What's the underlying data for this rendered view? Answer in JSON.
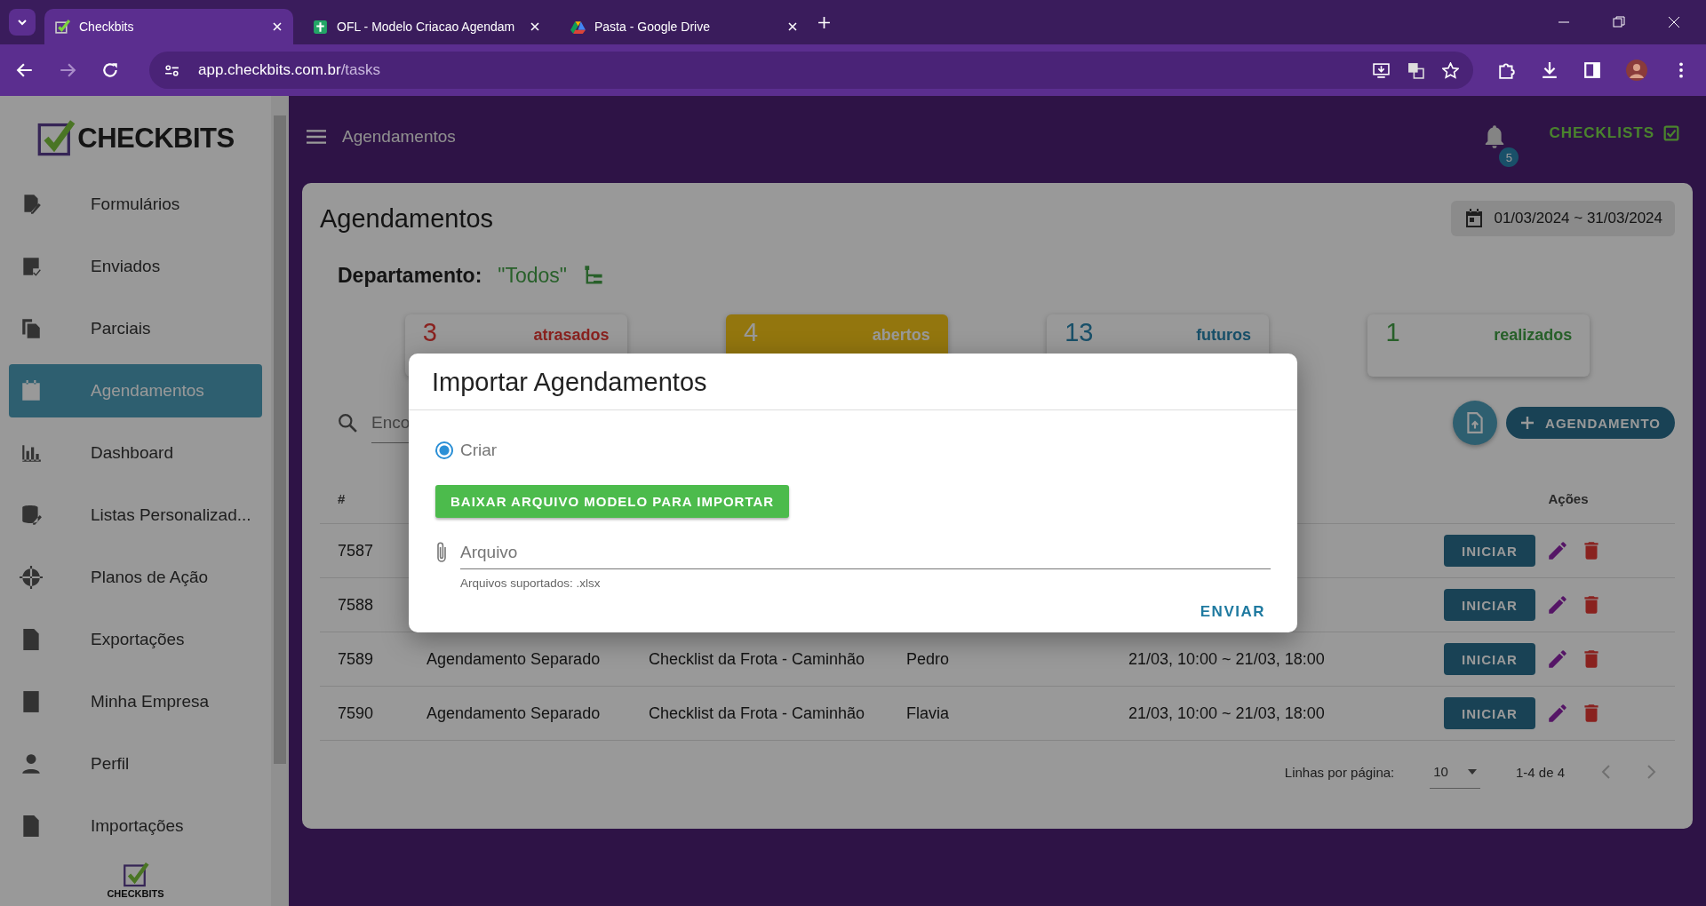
{
  "browser": {
    "tabs": [
      {
        "title": "Checkbits",
        "selected": true,
        "kind": "check"
      },
      {
        "title": "OFL - Modelo Criacao Agendam",
        "selected": false,
        "kind": "sheet"
      },
      {
        "title": "Pasta - Google Drive",
        "selected": false,
        "kind": "drive"
      }
    ],
    "url_host": "app.checkbits.com.br",
    "url_path": "/tasks"
  },
  "sidebar": {
    "logo": "CHECKBITS",
    "items": [
      {
        "label": "Formulários",
        "selected": false
      },
      {
        "label": "Enviados",
        "selected": false
      },
      {
        "label": "Parciais",
        "selected": false
      },
      {
        "label": "Agendamentos",
        "selected": true
      },
      {
        "label": "Dashboard",
        "selected": false
      },
      {
        "label": "Listas Personalizad...",
        "selected": false
      },
      {
        "label": "Planos de Ação",
        "selected": false
      },
      {
        "label": "Exportações",
        "selected": false
      },
      {
        "label": "Minha Empresa",
        "selected": false
      },
      {
        "label": "Perfil",
        "selected": false
      },
      {
        "label": "Importações",
        "selected": false
      }
    ],
    "footer_logo": "CHECKBITS"
  },
  "header": {
    "title": "Agendamentos",
    "notifications": "5",
    "checklists": "CHECKLISTS"
  },
  "page": {
    "title": "Agendamentos",
    "date_range": "01/03/2024 ~ 31/03/2024",
    "department_label": "Departamento:",
    "department_value": "\"Todos\""
  },
  "stats": [
    {
      "count": "3",
      "label": "atrasados",
      "kind": "late"
    },
    {
      "count": "4",
      "label": "abertos",
      "kind": "open"
    },
    {
      "count": "13",
      "label": "futuros",
      "kind": "future"
    },
    {
      "count": "1",
      "label": "realizados",
      "kind": "done"
    }
  ],
  "search": {
    "placeholder": "Enco"
  },
  "new_button": "AGENDAMENTO",
  "table": {
    "columns": [
      {
        "label": "#",
        "kind": "id"
      },
      {
        "label": "Ações",
        "kind": "actions"
      }
    ],
    "rows": [
      {
        "id": "7587",
        "action": "INICIAR"
      },
      {
        "id": "7588",
        "action": "INICIAR"
      },
      {
        "id": "7589",
        "name": "Agendamento Separado",
        "checklist": "Checklist da Frota - Caminhão",
        "user": "Pedro",
        "period": "21/03, 10:00 ~ 21/03, 18:00",
        "action": "INICIAR"
      },
      {
        "id": "7590",
        "name": "Agendamento Separado",
        "checklist": "Checklist da Frota - Caminhão",
        "user": "Flavia",
        "period": "21/03, 10:00 ~ 21/03, 18:00",
        "action": "INICIAR"
      }
    ]
  },
  "pagination": {
    "rows_label": "Linhas por página:",
    "rows_value": "10",
    "range": "1-4 de 4"
  },
  "dialog": {
    "title": "Importar Agendamentos",
    "options": [
      {
        "label": "Criar",
        "selected": true
      }
    ],
    "download_button": "BAIXAR ARQUIVO MODELO PARA IMPORTAR",
    "file_field": {
      "placeholder": "Arquivo",
      "hint": "Arquivos suportados: .xlsx"
    },
    "submit": "ENVIAR"
  }
}
